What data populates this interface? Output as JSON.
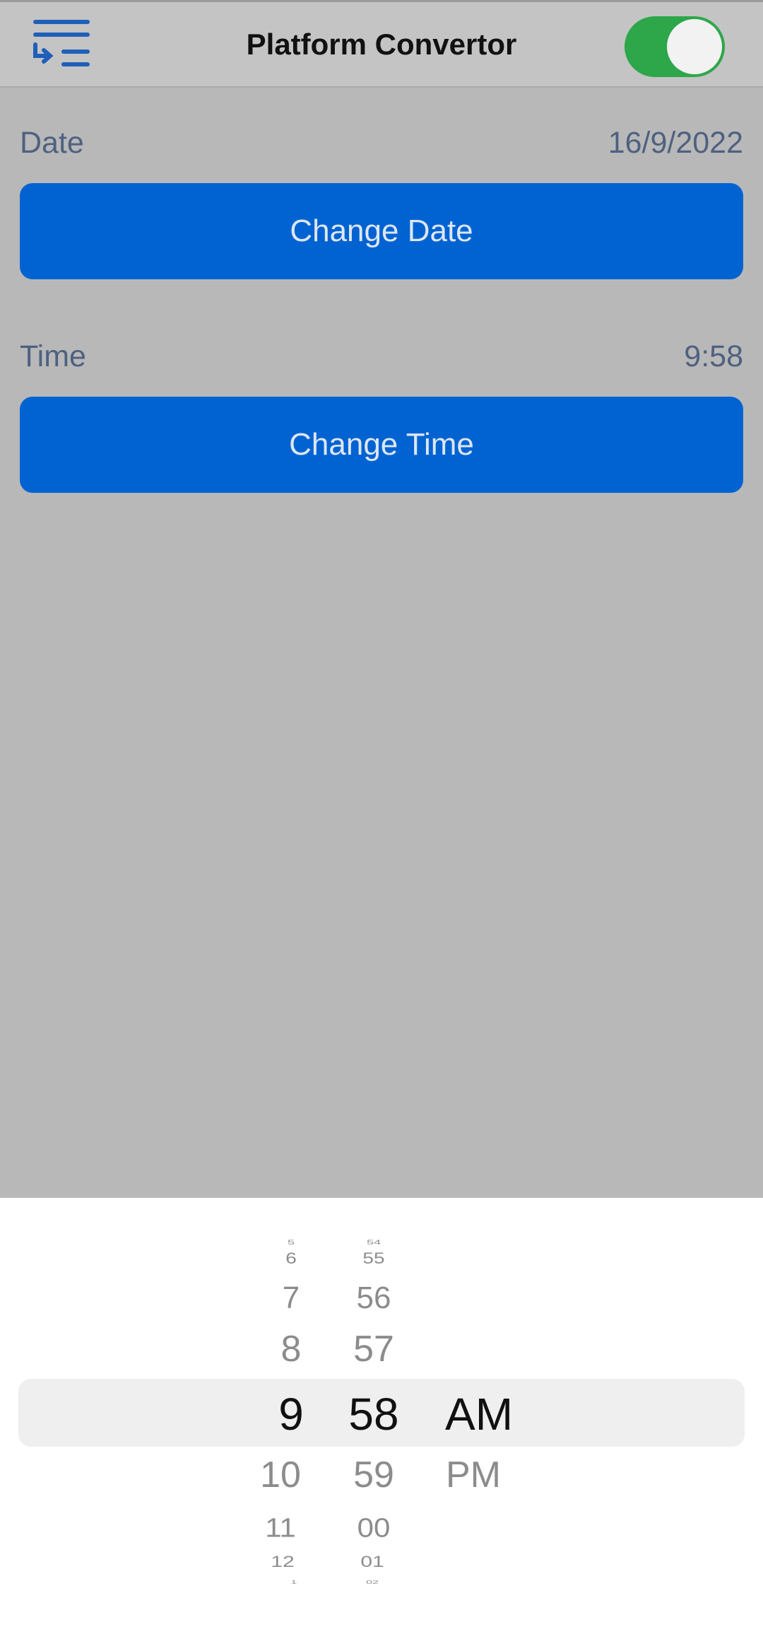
{
  "header": {
    "title": "Platform Convertor",
    "menu_icon": "indent-list-icon",
    "toggle_on": true
  },
  "date_row": {
    "label": "Date",
    "value": "16/9/2022",
    "button_label": "Change Date"
  },
  "time_row": {
    "label": "Time",
    "value": "9:58",
    "button_label": "Change Time"
  },
  "picker": {
    "hours": [
      "5",
      "6",
      "7",
      "8",
      "9",
      "10",
      "11",
      "12",
      "1"
    ],
    "minutes": [
      "54",
      "55",
      "56",
      "57",
      "58",
      "59",
      "00",
      "01",
      "02"
    ],
    "periods": [
      "AM",
      "PM"
    ],
    "selected": {
      "hour": "9",
      "minute": "58",
      "period": "AM"
    }
  },
  "colors": {
    "accent": "#0063d1",
    "toggle": "#2ea64a",
    "label": "#4e6180",
    "background": "#b8b8b8",
    "header": "#c4c4c4"
  }
}
